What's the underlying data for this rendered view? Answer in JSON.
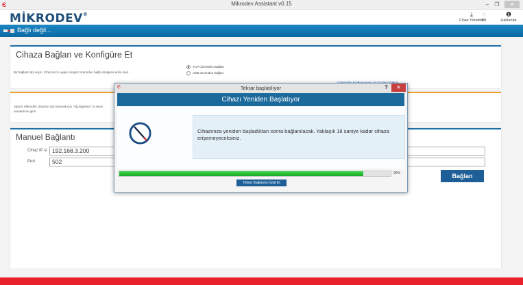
{
  "window": {
    "title": "Mikrodev Assistant v0.15",
    "minimize": "–",
    "maximize": "❐",
    "close": "✕"
  },
  "header": {
    "brand": "MİKRODEV",
    "brand_mark": "®",
    "tools": [
      {
        "label": "Cihaz Yönetimi",
        "icon": "download-icon"
      },
      {
        "label": "Dil",
        "icon": "globe-icon"
      },
      {
        "label": "Hakkında",
        "icon": "info-icon"
      }
    ]
  },
  "status": {
    "text": "Bağlı değil...",
    "icon": "plug-disconnected-icon"
  },
  "colors": {
    "accent": "#1c6a9c",
    "brand": "#1f4e7a",
    "alert": "#e8202a",
    "progress": "#18a92b"
  },
  "connect_card": {
    "title": "Cihaza Bağlan ve Konfigüre Et",
    "hint": "Bir bağlantı tipi seçin. Cihazınızın uygun arayüz üzerinden bağlı olduğuna emin olun",
    "option_tcp": "TCP Üzerinden Bağlan",
    "option_usb": "USB üzerinden bağlan",
    "selected": "TCP Üzerinden Bağlan",
    "offline_link": "Çevrimdışı konfigurasyon için buraya tıklayın"
  },
  "scan_card": {
    "text": "Ağınızı Mikrodev cihazları için taramak için \"Ağ Algılama\" yı seçin",
    "text2": "numarasını girin"
  },
  "manual_card": {
    "title": "Manuel Bağlantı",
    "ip_label": "Cihaz IP si",
    "ip_value": "192.168.3.200",
    "port_label": "Port",
    "port_value": "502",
    "connect_button": "Bağlan"
  },
  "dialog": {
    "window_title": "Tekrar başlatılıyor",
    "help": "?",
    "close": "✕",
    "header": "Cihazı Yeniden Başlatıyor",
    "message": "Cihazınıza yeniden başladıktan sonra bağlanılacak. Yaklaşık 18 saniye kadar cihaza erişemeyeceksiniz.",
    "progress_percent": 90,
    "progress_text": "90%",
    "cancel_button": "Tekrar Bağlantıyı İptal Et"
  }
}
